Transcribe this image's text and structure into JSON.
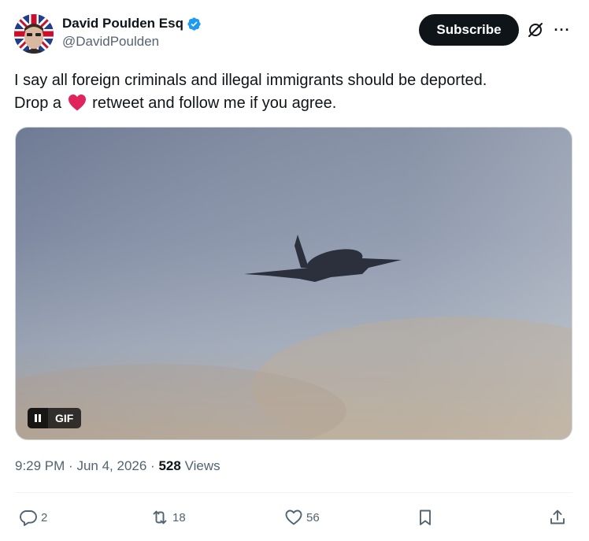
{
  "author": {
    "display_name": "David Poulden Esq",
    "handle": "@DavidPoulden",
    "verified": true,
    "avatar_icon": "union-flag-avatar"
  },
  "header": {
    "subscribe_label": "Subscribe",
    "grok_icon": "grok-icon",
    "more_icon": "more-icon",
    "more_glyph": "···"
  },
  "tweet": {
    "line1": "I say all foreign criminals and illegal immigrants should be deported.",
    "line2_before": "Drop a",
    "line2_after": "retweet and follow me if you agree.",
    "emoji": "heart-emoji"
  },
  "media": {
    "type": "gif",
    "badge_label": "GIF",
    "description_icon": "airplane-in-sky"
  },
  "meta": {
    "time": "9:29 PM",
    "separator1": "·",
    "date": "Jun 4, 2026",
    "separator2": "·",
    "views_count": "528",
    "views_label": "Views"
  },
  "actions": {
    "replies": "2",
    "reposts": "18",
    "likes": "56"
  },
  "colors": {
    "text_primary": "#0f1419",
    "text_secondary": "#536471",
    "verified_blue": "#1d9bf0",
    "button_dark": "#0f1419",
    "heart_red": "#e0245e",
    "divider": "#eff3f4"
  }
}
